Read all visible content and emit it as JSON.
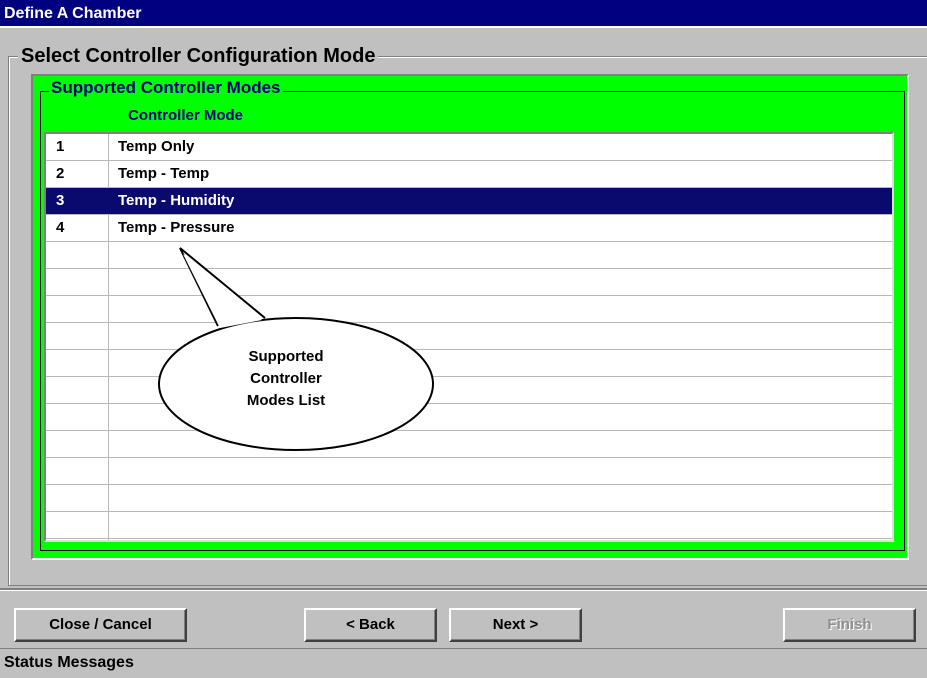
{
  "window": {
    "title": "Define A Chamber"
  },
  "config_group": {
    "label": "Select Controller Configuration Mode"
  },
  "modes_group": {
    "label": "Supported Controller Modes",
    "column_header": "Controller Mode",
    "rows": [
      {
        "num": "1",
        "mode": "Temp Only",
        "selected": false
      },
      {
        "num": "2",
        "mode": "Temp - Temp",
        "selected": false
      },
      {
        "num": "3",
        "mode": "Temp - Humidity",
        "selected": true
      },
      {
        "num": "4",
        "mode": "Temp - Pressure",
        "selected": false
      }
    ],
    "empty_row_count": 11,
    "highlight_color": "#00ff00",
    "selection_color": "#0a0a6e"
  },
  "callout": {
    "line1": "Supported",
    "line2": "Controller",
    "line3": "Modes List"
  },
  "buttons": {
    "close": "Close / Cancel",
    "back": "< Back",
    "next": "Next >",
    "finish": "Finish"
  },
  "status": {
    "label": "Status Messages"
  }
}
